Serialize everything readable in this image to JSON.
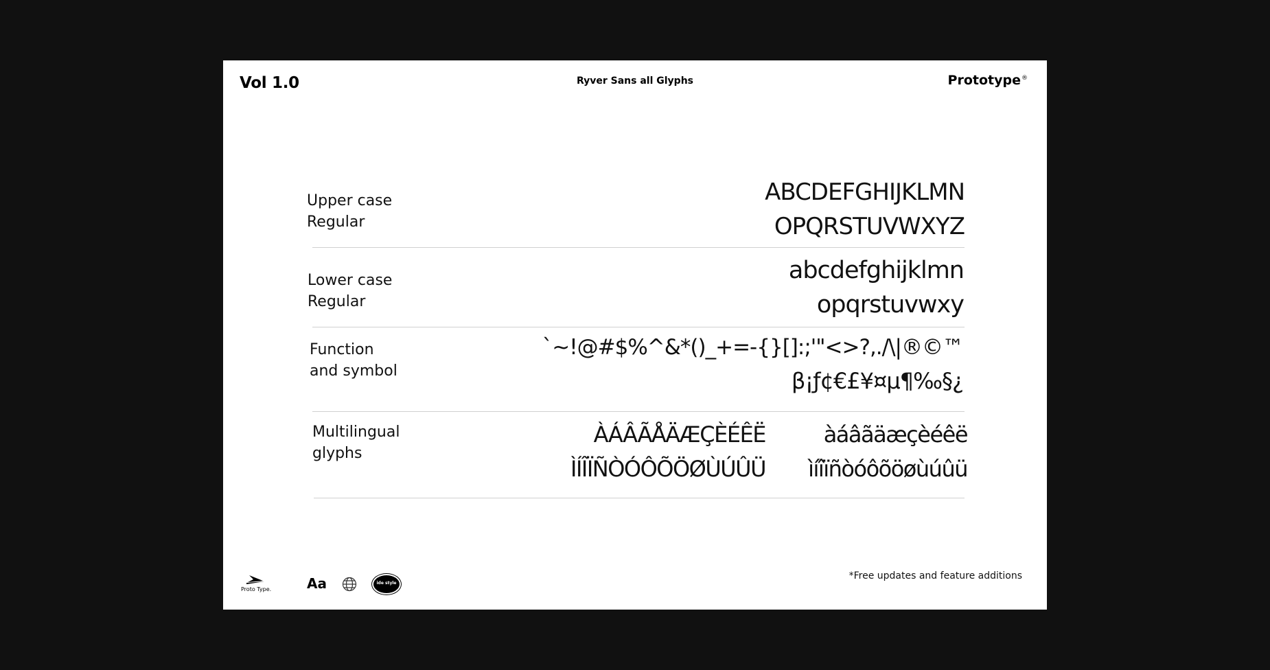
{
  "header": {
    "volume": "Vol 1.0",
    "title": "Ryver Sans all Glyphs",
    "brand": "Prototype",
    "brand_mark": "®"
  },
  "sections": [
    {
      "label_line1": "Upper case",
      "label_line2": "Regular",
      "glyphs_line1": "ABCDEFGHIJKLMN",
      "glyphs_line2": "OPQRSTUVWXYZ"
    },
    {
      "label_line1": "Lower case",
      "label_line2": "Regular",
      "glyphs_line1": "abcdefghijklmn",
      "glyphs_line2": "opqrstuvwxy"
    },
    {
      "label_line1": "Function",
      "label_line2": "and symbol",
      "glyphs_line1": "`~!@#$%^&*()_+=-{}[]:;'\"<>?,./\\|®©™",
      "glyphs_line2": "β¡ƒ¢€£¥¤µ¶‰§¿"
    },
    {
      "label_line1": "Multilingual",
      "label_line2": "glyphs",
      "upper_line1": "ÀÁÂÃÅÄÆÇÈÉÊË",
      "upper_line2": "ÌÍÎÏÑÒÓÔÕÖØÙÚÛÜ",
      "lower_line1": "àáâãäæçèéêë",
      "lower_line2": "ìíîïñòóôõöøùúûü"
    }
  ],
  "footer": {
    "logo_text": "Proto Type.",
    "aa_label": "Aa",
    "badge_text": "ide style",
    "note": "*Free updates and feature additions"
  },
  "icons": [
    "prototype-logo-icon",
    "type-aa-icon",
    "globe-icon",
    "style-badge-icon"
  ]
}
